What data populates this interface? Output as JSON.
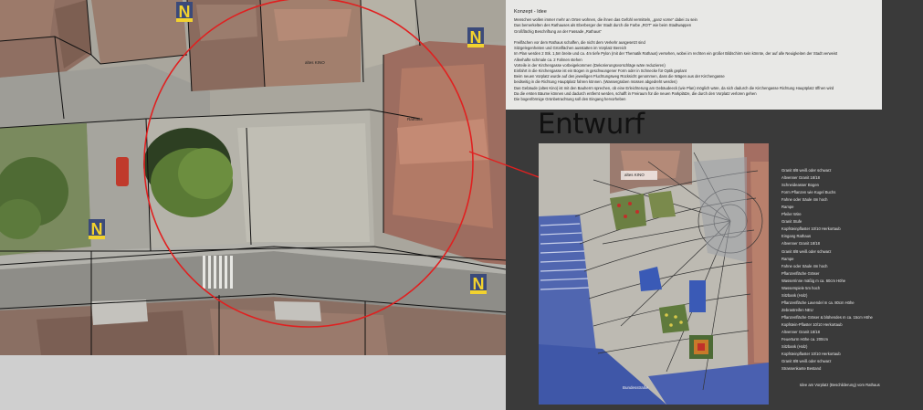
{
  "concept": {
    "title": "Konzept - Idee",
    "lines": [
      "Menschen wollen immer mehr an Orten wohnen, die ihnen das Gefühl vermitteln, „ganz vorne“ dabei zu sein",
      "Das bemerkelten des Rathauses als Eberberger der Stadt durch die Farbe „ROT“ wie beim Stadtwappen",
      "Großflächig Beschriftung an der Fassade „Rathaus“",
      "",
      "Freiflächen vor dem Rathaus schaffen, die nicht dem Verkehr ausgesetzt sind",
      "Sitzgelegenheiten und Grünflächen ausstatten im Vorplatz Bereich",
      "Im Plan werden 2 Stk. 1,5m breite und ca. 4m tiefe Pylon (mit der Thematik Rathaus) versehen, wobei im rechten ein großer Bildschirm sein könnte, der auf alle Neuigkeiten der Stadt verweist",
      "Alleehafte schmale ca. 2 Fahnen stehen",
      "Vorteile in der Kirchengasse vorbeigekommen (Dekorierungsvorschläge wäre reduzieren)",
      "Einfahrt in die Kirchengasse ist ein Bogen in geschwungener Form oder in Schnecke für Optik geplant",
      "Beim neuen Vorplatz wurde auf den jeweiligen Fluchtungsweg Rücksicht genommen, dass die Wägen aus der Kirchengasse",
      "beidseitig in die Richtung Hauptplatz fahren können. (Wassergraben müssen abgedreht werden)",
      "Das Gebäude (altes Kino) ist mit den Bauherrn sprechen, ob eine Erleichterung am Gebäudeeck (wie Plan) möglich wäre, da sich dadurch die Kirchengasse Richtung Hauptplatz öffnen wird",
      "Da die ersten Bäume können und dadurch entfernt werden, schafft in Freiraum für die neuen Parkplätze, die durch den Vorplatz verloren gehen",
      "Die bogenförmige Grünbetrachtung soll den Eingang hervorheben"
    ]
  },
  "entwurf_title": "Entwurf",
  "plan": {
    "label_altes_kino": "altes KINO",
    "label_bundesstrasse": "Bundesstraße"
  },
  "map": {
    "label_altes_kino": "altes KINO",
    "label_rathaus": "Rathaus",
    "badge_letter": "N"
  },
  "legend": [
    "Granit 8/8 weiß oder schwarz",
    "Altvenner Granit 18/18",
    "Schneideasser Bogen",
    "Form Pflanzen wie Kugel Buchs",
    "Fahne oder Säule 4m hoch",
    "Rampe",
    "Pfeiler Wire",
    "Granit Stufe",
    "Kopfsteinpflaster 10/10 Herkortaub",
    "Eingang Rathaus",
    "Altvenner Granit 18/18",
    "Granit 8/8 weiß oder schwarz",
    "Rampe",
    "Fahne oder Säule 4m hoch",
    "Pflanzenfläche Gräser",
    "Wasserrinne mäßig m ca. 60cm Höhe",
    "Wasserspiele 5m hoch",
    "Sitzbank (Holz)",
    "Pflanzenfläche Lavendel m ca. 80cm Höhe",
    "Zebrastreifen NEU",
    "Pflanzenfläche Gräser & blühendes m ca. 15cm Höhe",
    "Kopfstein-Pflaster 10/10 Herkortaub",
    "Altvenner Granit 18/18",
    "Feuerturm Höhe ca. 200cm",
    "Sitzbank (Holz)",
    "Kopfsteinpflaster 10/10 Herkortaub",
    "Granit 8/8 weiß oder schwarz",
    "Strassenkante Bestand"
  ],
  "caption": "Idee am Vorplatz (Beschilderung) vom Rathaus",
  "colors": {
    "highlight_circle": "#e02020",
    "dark_panel": "#3a3a3a",
    "badge_yellow": "#f2d22e",
    "badge_blue": "#3b4a7a"
  }
}
